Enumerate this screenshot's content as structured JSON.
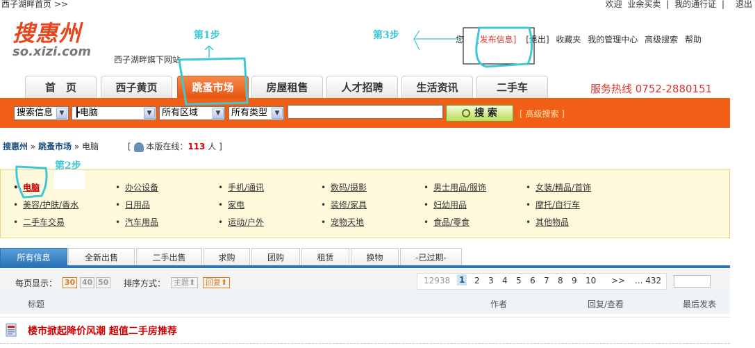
{
  "topbar": {
    "home": "西子湖畔首页 >>",
    "links": [
      "欢迎",
      "业余买卖",
      "|",
      "我的通行证",
      "|"
    ],
    "logout": "退出"
  },
  "logo": {
    "cn": "搜惠州",
    "en": "so.xizi.com"
  },
  "slogan": "西子湖畔旗下网站",
  "userlinks": {
    "prefix": "您",
    "publish": "[发布信息]",
    "exit": "[退出]",
    "favorites": "收藏夹",
    "admin": "我的管理中心",
    "advanced": "高级搜索",
    "help": "帮助"
  },
  "nav": {
    "tabs": [
      "首　页",
      "西子黄页",
      "跳蚤市场",
      "房屋租售",
      "人才招聘",
      "生活资讯",
      "二手车"
    ],
    "active": "跳蚤市场"
  },
  "hotline": "服务热线 0752-2880151",
  "search": {
    "scope": "搜索信息",
    "category": "┣电脑",
    "region": "所有区域",
    "type": "所有类型",
    "input_value": "",
    "button": "搜 索",
    "advanced": "[ 高级搜索 ]"
  },
  "breadcrumb": {
    "root": "搜惠州",
    "sep1": "»",
    "market": "跳蚤市场",
    "sep2": "»",
    "current": "电脑"
  },
  "online": {
    "prefix": "本版在线：",
    "count": "113",
    "suffix": "人"
  },
  "categories": [
    [
      "电脑",
      "办公设备",
      "手机/通讯",
      "数码/摄影",
      "男士用品/服饰",
      "女装/精品/首饰"
    ],
    [
      "美容/护肤/香水",
      "日用品",
      "家电",
      "装修/家具",
      "妇幼用品",
      "摩托/自行车"
    ],
    [
      "二手车交易",
      "汽车用品",
      "运动/户外",
      "宠物天地",
      "食品/零食",
      "其他物品"
    ]
  ],
  "info_tabs": [
    "所有信息",
    "全新出售",
    "二手出售",
    "求购",
    "团购",
    "租赁",
    "换物",
    "-已过期-"
  ],
  "pager": {
    "per_page_label": "每页显示：",
    "per_page_options": [
      "30",
      "40",
      "50"
    ],
    "sort_label": "排序方式：",
    "sort_options": [
      "主题⬆",
      "回复⬆"
    ],
    "total": "12938",
    "pages": [
      "1",
      "2",
      "3",
      "4",
      "5",
      "6",
      "7",
      "8",
      "9",
      "10"
    ],
    "next": ">>",
    "last": "... 432"
  },
  "list_header": {
    "title": "标题",
    "author": "作者",
    "replies": "回复/查看",
    "last": "最后发表"
  },
  "rows": [
    {
      "title": "楼市掀起降价风潮 超值二手房推荐"
    }
  ],
  "annotations": {
    "step1": "第1步",
    "step2": "第2步",
    "step3": "第3步"
  },
  "colors": {
    "accent": "#f05f15",
    "link": "#1b4f80",
    "highlight": "#3cc8d6",
    "red": "#d33"
  }
}
